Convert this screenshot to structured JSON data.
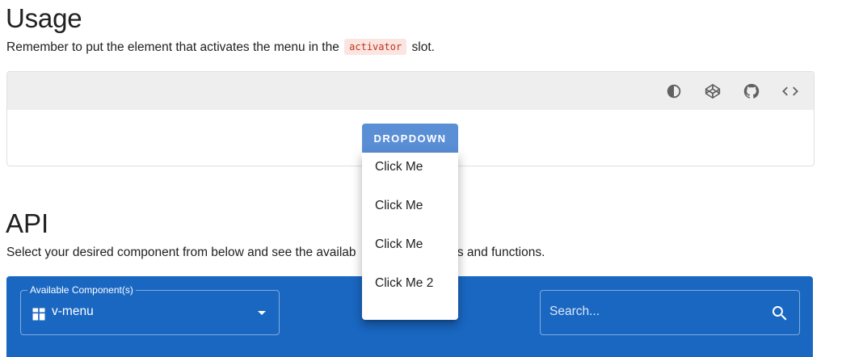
{
  "usage": {
    "title": "Usage",
    "text_before": "Remember to put the element that activates the menu in the",
    "code": "activator",
    "text_after": "slot."
  },
  "example": {
    "toolbar_icons": [
      "invert-colors-icon",
      "codepen-icon",
      "github-icon",
      "code-tags-icon"
    ],
    "button_label": "DROPDOWN",
    "menu_items": [
      "Click Me",
      "Click Me",
      "Click Me",
      "Click Me 2"
    ]
  },
  "api": {
    "title": "API",
    "description_visible_start": "Select your desired component from below and see the availab",
    "description_visible_end": "vents and functions.",
    "component_label": "Available Component(s)",
    "component_value": "v-menu",
    "search_placeholder": "Search..."
  },
  "colors": {
    "primary": "#1a67c2",
    "button": "#5a8fd6",
    "code_text": "#c0341d",
    "code_bg": "#fbe5e1"
  }
}
